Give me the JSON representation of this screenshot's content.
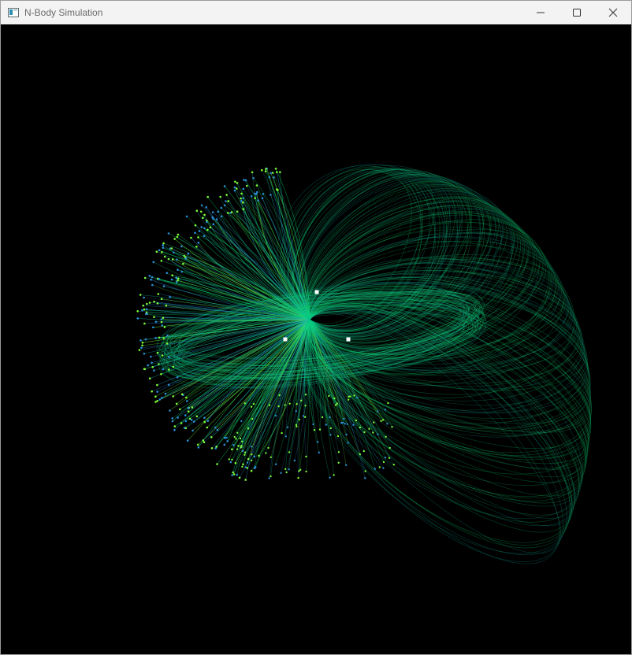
{
  "window": {
    "title": "N-Body Simulation",
    "controls": {
      "minimize_icon": "minimize-icon",
      "maximize_icon": "maximize-icon",
      "close_icon": "close-icon"
    }
  },
  "simulation": {
    "background": "#000000",
    "trail_colors": [
      "#00e676",
      "#19d27a",
      "#0fb39a",
      "#2a8fd6",
      "#7cff3a"
    ],
    "massive_body_color": "#ffffff",
    "massive_body_count": 3
  }
}
